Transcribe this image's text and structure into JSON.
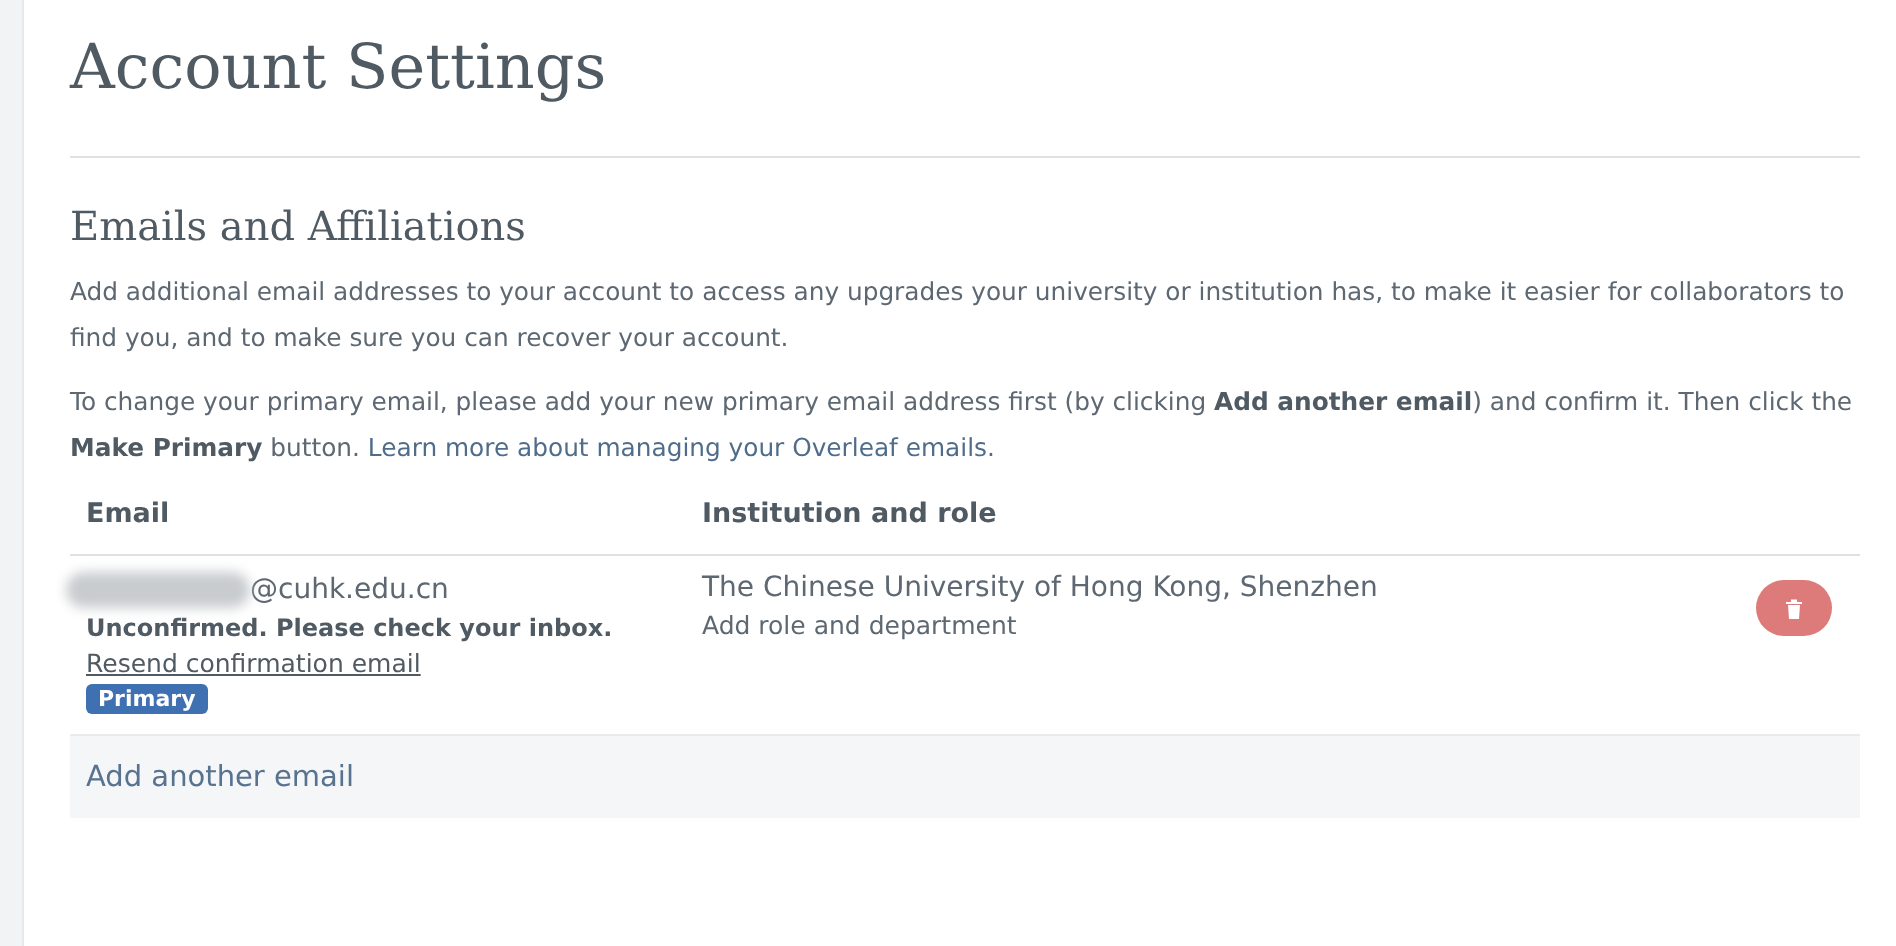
{
  "page": {
    "title": "Account Settings"
  },
  "section": {
    "title": "Emails and Affiliations",
    "paragraphs": [
      {
        "text": "Add additional email addresses to your account to access any upgrades your university or institution has, to make it easier for collaborators to find you, and to make sure you can recover your account."
      },
      {
        "text": "To change your primary email, please add your new primary email address first (by clicking **Add another email**) and confirm it. Then click the **Make Primary** button.",
        "link": "Learn more about managing your Overleaf emails."
      }
    ]
  },
  "table": {
    "columns": [
      "Email",
      "Institution and role"
    ],
    "rows": [
      {
        "email": "@cuhk.edu.cn",
        "redacted": true,
        "status": "Unconfirmed. Please check your inbox.",
        "resend": "Resend confirmation email",
        "badge": "Primary",
        "institution": "The Chinese University of Hong Kong, Shenzhen",
        "role_link": "Add role and department"
      }
    ],
    "add_link": "Add another email"
  }
}
